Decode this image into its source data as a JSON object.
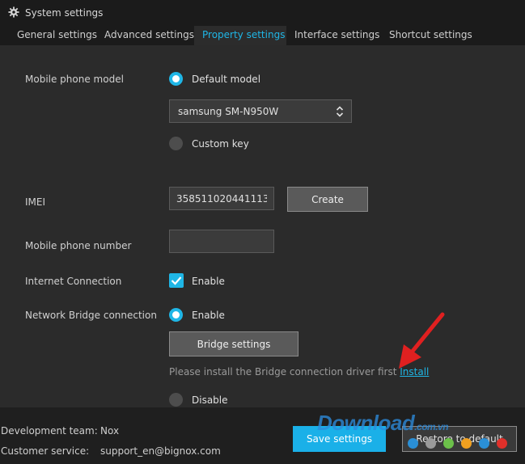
{
  "window": {
    "title": "System settings",
    "icon": "gear-icon"
  },
  "tabs": [
    {
      "label": "General settings"
    },
    {
      "label": "Advanced settings"
    },
    {
      "label": "Property settings",
      "active": true
    },
    {
      "label": "Interface settings"
    },
    {
      "label": "Shortcut settings"
    }
  ],
  "model": {
    "label": "Mobile phone model",
    "default_label": "Default model",
    "selected": "samsung SM-N950W",
    "custom_label": "Custom key",
    "mode": "default"
  },
  "imei": {
    "label": "IMEI",
    "value": "358511020441113",
    "create_label": "Create"
  },
  "phone": {
    "label": "Mobile phone number",
    "value": ""
  },
  "internet": {
    "label": "Internet Connection",
    "enable_label": "Enable",
    "checked": true
  },
  "bridge": {
    "label": "Network Bridge connection",
    "enable_label": "Enable",
    "settings_label": "Bridge settings",
    "note": "Please install the Bridge connection driver first",
    "install_link": "Install",
    "disable_label": "Disable",
    "mode": "enable"
  },
  "footer": {
    "dev_label": "Development team:",
    "dev_value": "Nox",
    "service_label": "Customer service:",
    "service_value": "support_en@bignox.com",
    "save_label": "Save settings",
    "restore_label": "Restore to default"
  },
  "watermark": {
    "text": "Download",
    "suffix": ".com.vn",
    "dot_colors": [
      "#2a8fd6",
      "#9a9a9a",
      "#6cc04a",
      "#f0a020",
      "#2a8fd6",
      "#e0302a"
    ]
  },
  "colors": {
    "accent": "#1fb6e6",
    "annotation_arrow": "#e02020"
  }
}
